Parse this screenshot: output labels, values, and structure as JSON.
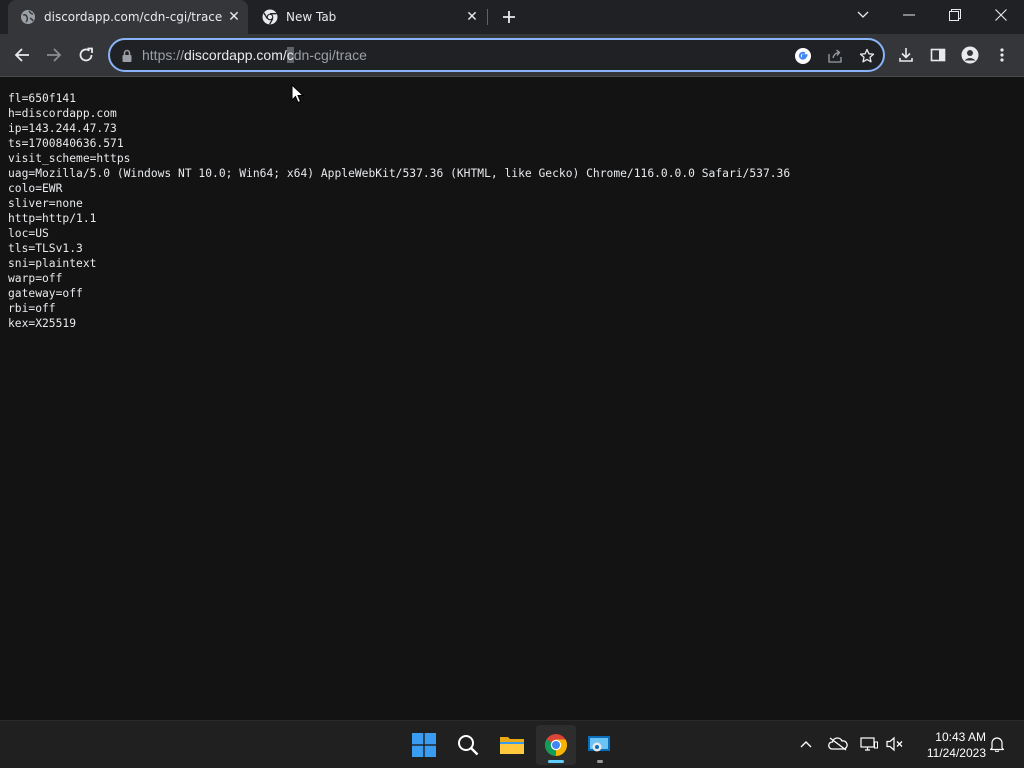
{
  "browser": {
    "tabs": [
      {
        "title": "discordapp.com/cdn-cgi/trace",
        "active": true
      },
      {
        "title": "New Tab",
        "active": false
      }
    ],
    "url": {
      "scheme": "https://",
      "host": "discordapp.com/",
      "caret_char": "c",
      "path": "dn-cgi/trace"
    }
  },
  "page": {
    "trace_lines": [
      "fl=650f141",
      "h=discordapp.com",
      "ip=143.244.47.73",
      "ts=1700840636.571",
      "visit_scheme=https",
      "uag=Mozilla/5.0 (Windows NT 10.0; Win64; x64) AppleWebKit/537.36 (KHTML, like Gecko) Chrome/116.0.0.0 Safari/537.36",
      "colo=EWR",
      "sliver=none",
      "http=http/1.1",
      "loc=US",
      "tls=TLSv1.3",
      "sni=plaintext",
      "warp=off",
      "gateway=off",
      "rbi=off",
      "kex=X25519"
    ]
  },
  "taskbar": {
    "apps": [
      "start-icon",
      "search-icon",
      "file-explorer-icon",
      "chrome-icon",
      "remote-desktop-icon"
    ],
    "clock": {
      "time": "10:43 AM",
      "date": "11/24/2023"
    }
  },
  "colors": {
    "accent": "#8ab4f8",
    "page_bg": "#131313",
    "toolbar_bg": "#35363a",
    "tabstrip_bg": "#202124"
  }
}
